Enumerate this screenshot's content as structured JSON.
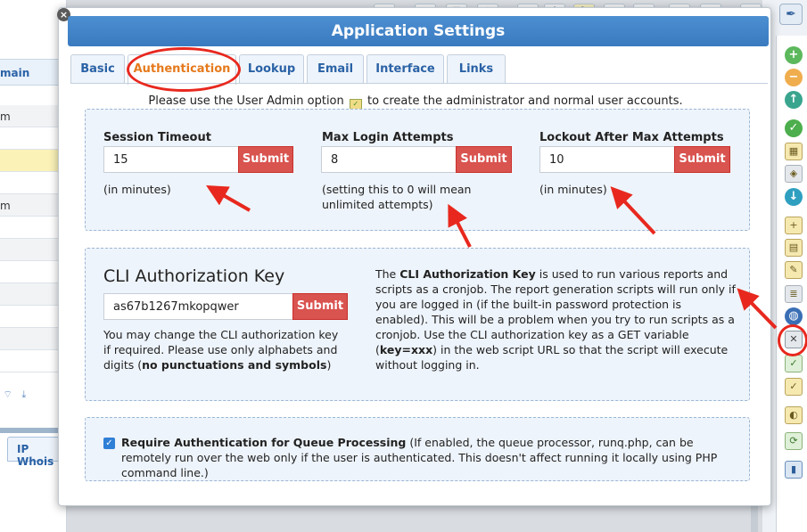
{
  "background": {
    "left_header": "main",
    "left_rows": [
      "",
      "m",
      "",
      "",
      "m",
      "",
      "",
      "",
      "",
      "",
      ""
    ],
    "whois_tab": "IP Whois"
  },
  "modal": {
    "title": "Application Settings",
    "close_icon": "close-icon",
    "tabs": [
      {
        "label": "Basic"
      },
      {
        "label": "Authentication",
        "active": true
      },
      {
        "label": "Lookup"
      },
      {
        "label": "Email"
      },
      {
        "label": "Interface"
      },
      {
        "label": "Links"
      }
    ],
    "intro_before": "Please use the User Admin option",
    "intro_after": "to create the administrator and normal user accounts.",
    "session": {
      "label": "Session Timeout",
      "value": "15",
      "submit": "Submit",
      "note": "(in minutes)"
    },
    "max_login": {
      "label": "Max Login Attempts",
      "value": "8",
      "submit": "Submit",
      "note_line1": "(setting this to 0 will mean",
      "note_line2": "unlimited attempts)"
    },
    "lockout": {
      "label": "Lockout After Max Attempts",
      "value": "10",
      "submit": "Submit",
      "note": "(in minutes)"
    },
    "cli": {
      "title": "CLI Authorization Key",
      "value": "as67b1267mkopqwer",
      "submit": "Submit",
      "help_text": "You may change the CLI authorization key if required. Please use only alphabets and digits (",
      "help_bold": "no punctuations and symbols",
      "help_end": ")",
      "desc_1": "The ",
      "desc_bold1": "CLI Authorization Key",
      "desc_2": " is used to run various reports and scripts as a cronjob. The report generation scripts will run only if you are logged in (if the built-in password protection is enabled). This will be a problem when you try to run scripts as a cronjob. Use the CLI authorization key as a GET variable (",
      "desc_bold2": "key=xxx",
      "desc_3": ") in the web script URL so that the script will execute without logging in."
    },
    "queue": {
      "checked": true,
      "label_bold": "Require Authentication for Queue Processing",
      "label_rest": " (If enabled, the queue processor, runq.php, can be remotely run over the web only if the user is authenticated. This doesn't affect running it locally using PHP command line.)"
    }
  },
  "colors": {
    "title_bar": "#3f82c8",
    "active_tab_text": "#e57a1c",
    "tab_text": "#2a62a6",
    "submit_bg": "#d9534f",
    "annotation_red": "#e8281e",
    "panel_bg": "#eef4fb"
  },
  "right_rail_icons": [
    "pen-icon",
    "add-icon",
    "remove-icon",
    "up-icon",
    "check-icon",
    "calendar-icon",
    "tag-icon",
    "down-icon",
    "add-page-icon",
    "folder-icon",
    "edit-icon",
    "report-icon",
    "globe-icon",
    "settings-icon",
    "checklist-icon",
    "note-icon",
    "palette-icon",
    "sync-icon",
    "book-icon"
  ]
}
